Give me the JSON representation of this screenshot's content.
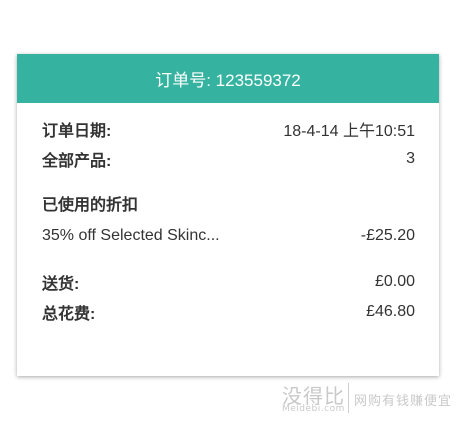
{
  "order": {
    "header": "订单号: 123559372",
    "date_label": "订单日期:",
    "date_value": "18-4-14 上午10:51",
    "products_label": "全部产品:",
    "products_value": "3",
    "discount_title": "已使用的折扣",
    "discount_name": "35% off Selected Skinc...",
    "discount_value": "-£25.20",
    "shipping_label": "送货:",
    "shipping_value": "£0.00",
    "total_label": "总花费:",
    "total_value": "£46.80"
  },
  "watermark": {
    "brand": "没得比",
    "domain": "Meidebi.com",
    "slogan": "网购有钱赚便宜"
  },
  "colors": {
    "header_bg": "#35b3a0",
    "header_text": "#ffffff",
    "body_text": "#333333"
  }
}
